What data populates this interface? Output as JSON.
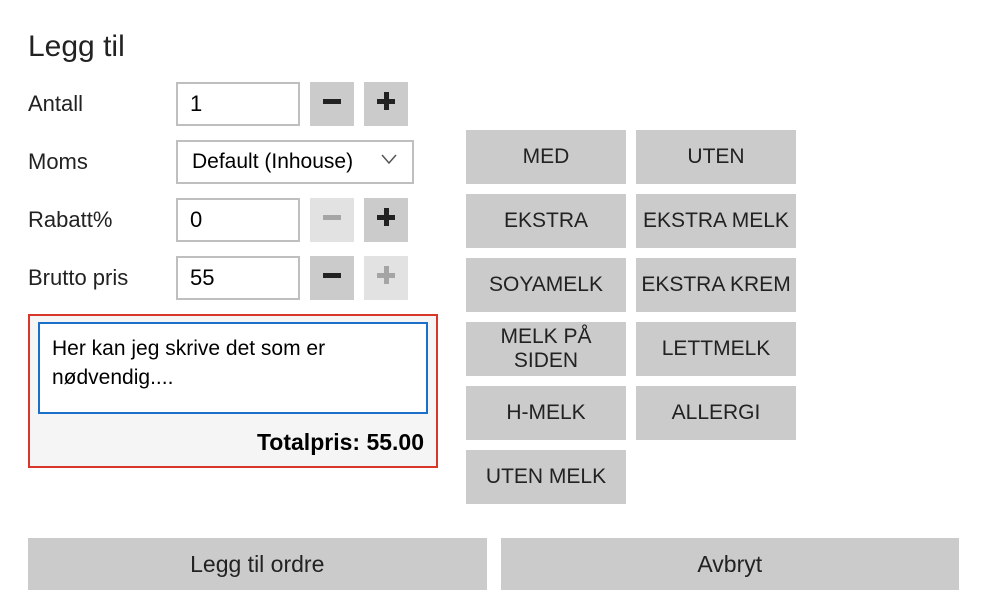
{
  "title": "Legg til",
  "rows": {
    "antall": {
      "label": "Antall",
      "value": "1"
    },
    "moms": {
      "label": "Moms",
      "value": "Default (Inhouse)"
    },
    "rabatt": {
      "label": "Rabatt%",
      "value": "0"
    },
    "brutto": {
      "label": "Brutto pris",
      "value": "55"
    }
  },
  "note": "Her kan jeg skrive det som er nødvendig....",
  "total": {
    "label": "Totalpris:",
    "value": "55.00"
  },
  "tags": [
    "MED",
    "UTEN",
    "EKSTRA",
    "EKSTRA MELK",
    "SOYAMELK",
    "EKSTRA KREM",
    "MELK PÅ SIDEN",
    "LETTMELK",
    "H-MELK",
    "ALLERGI",
    "UTEN MELK"
  ],
  "footer": {
    "add": "Legg til ordre",
    "cancel": "Avbryt"
  }
}
